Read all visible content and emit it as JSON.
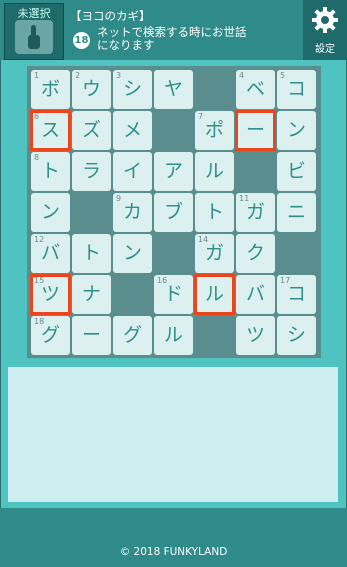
{
  "header": {
    "unselected_label": "未選択",
    "clue_hint": "【ヨコのカギ】",
    "clue_number": "18",
    "clue_text": "ネットで検索する時にお世話になります",
    "settings_label": "設定"
  },
  "board": {
    "rows": 7,
    "cols": 7,
    "cells": [
      {
        "r": 0,
        "c": 0,
        "ch": "ボ",
        "n": "1"
      },
      {
        "r": 0,
        "c": 1,
        "ch": "ウ",
        "n": "2"
      },
      {
        "r": 0,
        "c": 2,
        "ch": "シ",
        "n": "3"
      },
      {
        "r": 0,
        "c": 3,
        "ch": "ヤ",
        "n": ""
      },
      {
        "r": 0,
        "c": 5,
        "ch": "ベ",
        "n": "4"
      },
      {
        "r": 0,
        "c": 6,
        "ch": "コ",
        "n": "5"
      },
      {
        "r": 1,
        "c": 0,
        "ch": "ス",
        "n": "6",
        "sel": true
      },
      {
        "r": 1,
        "c": 1,
        "ch": "ズ",
        "n": ""
      },
      {
        "r": 1,
        "c": 2,
        "ch": "メ",
        "n": ""
      },
      {
        "r": 1,
        "c": 4,
        "ch": "ポ",
        "n": "7"
      },
      {
        "r": 1,
        "c": 5,
        "ch": "ー",
        "n": "",
        "sel": true
      },
      {
        "r": 1,
        "c": 6,
        "ch": "ン",
        "n": ""
      },
      {
        "r": 2,
        "c": 0,
        "ch": "ト",
        "n": "8"
      },
      {
        "r": 2,
        "c": 1,
        "ch": "ラ",
        "n": ""
      },
      {
        "r": 2,
        "c": 2,
        "ch": "イ",
        "n": ""
      },
      {
        "r": 2,
        "c": 3,
        "ch": "ア",
        "n": ""
      },
      {
        "r": 2,
        "c": 4,
        "ch": "ル",
        "n": ""
      },
      {
        "r": 2,
        "c": 6,
        "ch": "ビ",
        "n": ""
      },
      {
        "r": 3,
        "c": 0,
        "ch": "ン",
        "n": ""
      },
      {
        "r": 3,
        "c": 2,
        "ch": "カ",
        "n": "9"
      },
      {
        "r": 3,
        "c": 3,
        "ch": "ブ",
        "n": ""
      },
      {
        "r": 3,
        "c": 4,
        "ch": "ト",
        "n": ""
      },
      {
        "r": 3,
        "c": 5,
        "ch": "ガ",
        "n": "11"
      },
      {
        "r": 3,
        "c": 6,
        "ch": "ニ",
        "n": ""
      },
      {
        "r": 4,
        "c": 0,
        "ch": "バ",
        "n": "12"
      },
      {
        "r": 4,
        "c": 1,
        "ch": "ト",
        "n": ""
      },
      {
        "r": 4,
        "c": 2,
        "ch": "ン",
        "n": ""
      },
      {
        "r": 4,
        "c": 4,
        "ch": "ガ",
        "n": "14"
      },
      {
        "r": 4,
        "c": 5,
        "ch": "ク",
        "n": ""
      },
      {
        "r": 5,
        "c": 0,
        "ch": "ツ",
        "n": "15",
        "sel": true
      },
      {
        "r": 5,
        "c": 1,
        "ch": "ナ",
        "n": ""
      },
      {
        "r": 5,
        "c": 3,
        "ch": "ド",
        "n": "16"
      },
      {
        "r": 5,
        "c": 4,
        "ch": "ル",
        "n": "",
        "sel": true
      },
      {
        "r": 5,
        "c": 5,
        "ch": "バ",
        "n": ""
      },
      {
        "r": 5,
        "c": 6,
        "ch": "コ",
        "n": "17"
      },
      {
        "r": 6,
        "c": 0,
        "ch": "グ",
        "n": "18"
      },
      {
        "r": 6,
        "c": 1,
        "ch": "ー",
        "n": ""
      },
      {
        "r": 6,
        "c": 2,
        "ch": "グ",
        "n": ""
      },
      {
        "r": 6,
        "c": 3,
        "ch": "ル",
        "n": ""
      },
      {
        "r": 6,
        "c": 5,
        "ch": "ツ",
        "n": ""
      },
      {
        "r": 6,
        "c": 6,
        "ch": "シ",
        "n": ""
      }
    ]
  },
  "footer": {
    "copyright": "© 2018 FUNKYLAND"
  },
  "colors": {
    "header": "#2f8a8a",
    "board": "#5a8e8e",
    "tile": "#dcf0f0",
    "letter": "#2f8f8b",
    "selected": "#e8461f",
    "background": "#4ec3c0"
  }
}
